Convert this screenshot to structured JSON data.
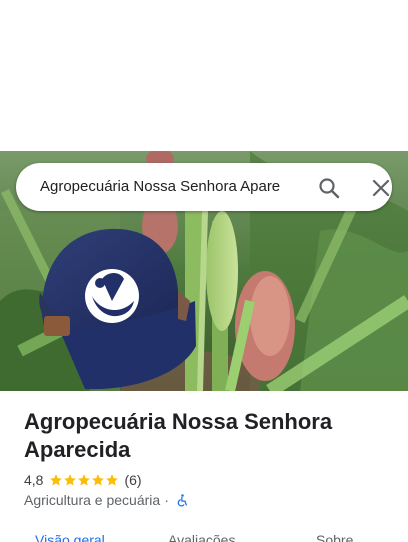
{
  "search": {
    "query": "Agropecuária Nossa Senhora Apare"
  },
  "icons": {
    "search": "search-icon",
    "close": "close-icon",
    "star": "star-icon",
    "accessibility": "wheelchair-accessible-icon"
  },
  "place": {
    "title": "Agropecuária Nossa Senhora Aparecida",
    "rating": "4,8",
    "star_count": 5,
    "review_count": "(6)",
    "category": "Agricultura e pecuária",
    "separator": "·"
  },
  "tabs": [
    {
      "label": "Visão geral",
      "active": true
    },
    {
      "label": "Avaliações",
      "active": false
    },
    {
      "label": "Sobre",
      "active": false
    }
  ],
  "colors": {
    "accent": "#1a73e8",
    "star": "#fbbc04",
    "text_primary": "#202124",
    "text_secondary": "#5f6368"
  }
}
